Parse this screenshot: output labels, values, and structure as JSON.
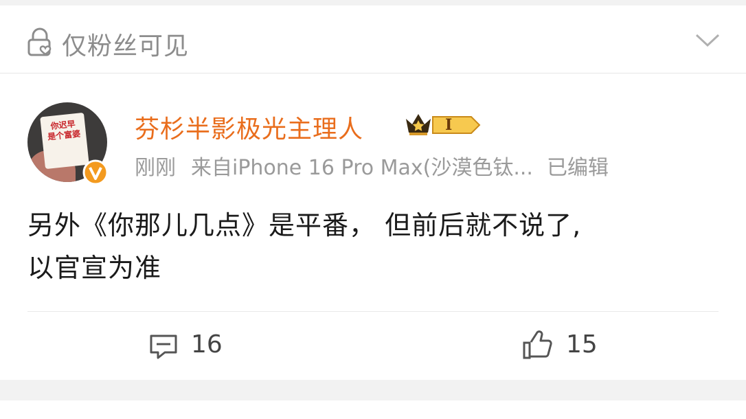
{
  "visibility": {
    "label": "仅粉丝可见"
  },
  "post": {
    "author": {
      "name": "芬杉半影极光主理人",
      "level_badge": "I"
    },
    "avatar_text": "你迟早\n是个富婆",
    "meta": {
      "time": "刚刚",
      "source": "来自iPhone 16 Pro Max(沙漠色钛...",
      "edited": "已编辑"
    },
    "content_line1": "另外《你那儿几点》是平番， 但前后就不说了,",
    "content_line2": "以官宣为准",
    "actions": {
      "comments": "16",
      "likes": "15"
    }
  },
  "colors": {
    "username": "#e96d1c",
    "verified": "#f39a1f",
    "muted": "#9a9a9a",
    "text": "#1a1a1a"
  }
}
